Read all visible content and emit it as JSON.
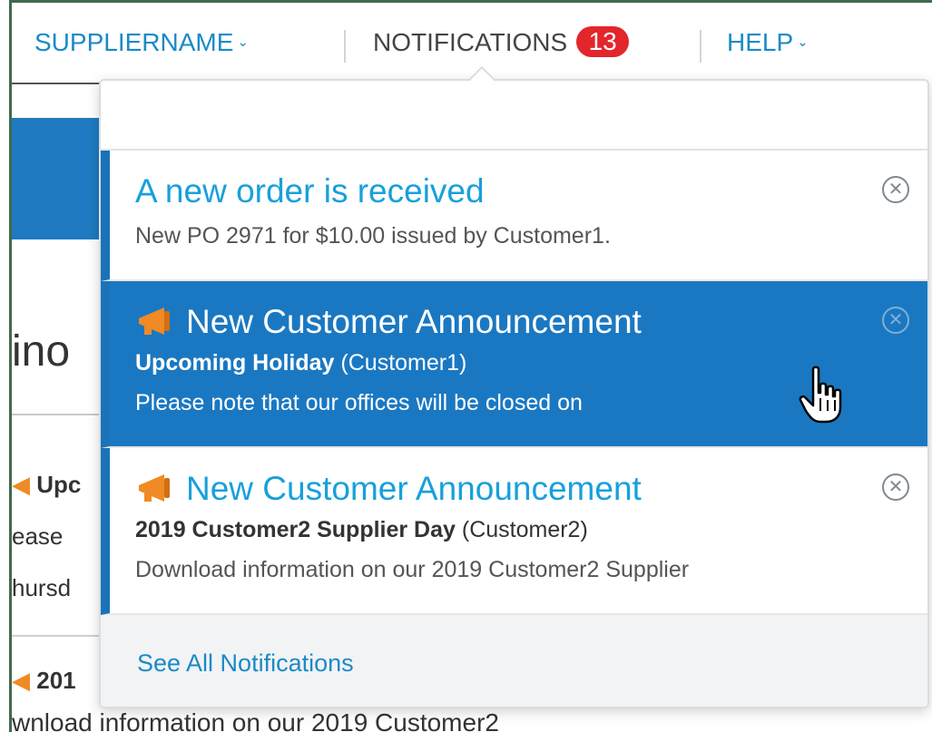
{
  "topnav": {
    "supplier_label": "SUPPLIERNAME",
    "notifications_label": "NOTIFICATIONS",
    "notifications_count": "13",
    "help_label": "HELP",
    "chevron_glyph": "⌄"
  },
  "background": {
    "heading_fragment": "ino",
    "rows": [
      {
        "icon": "megaphone-icon",
        "text": "Upc"
      },
      {
        "text": "ease"
      },
      {
        "text": "hursd"
      }
    ],
    "row2": {
      "icon": "megaphone-icon",
      "text": "201"
    },
    "bottom_text": "wnload information on our 2019 Customer2"
  },
  "notifications": [
    {
      "type": "order",
      "title": "A new order is received",
      "body": "New PO 2971 for $10.00 issued by Customer1.",
      "highlighted": false
    },
    {
      "type": "announcement",
      "icon": "megaphone-icon",
      "title": "New Customer Announcement",
      "subject": "Upcoming Holiday",
      "customer": "(Customer1)",
      "body": "Please note that our offices will be closed on",
      "highlighted": true
    },
    {
      "type": "announcement",
      "icon": "megaphone-icon",
      "title": "New Customer Announcement",
      "subject": "2019 Customer2 Supplier Day",
      "customer": "(Customer2)",
      "body": "Download information on our 2019 Customer2 Supplier",
      "highlighted": false
    }
  ],
  "footer": {
    "see_all_label": "See All Notifications"
  },
  "colors": {
    "accent": "#1a8ac6",
    "highlight": "#1a78c2",
    "badge": "#e3262b",
    "megaphone": "#f08a24"
  }
}
